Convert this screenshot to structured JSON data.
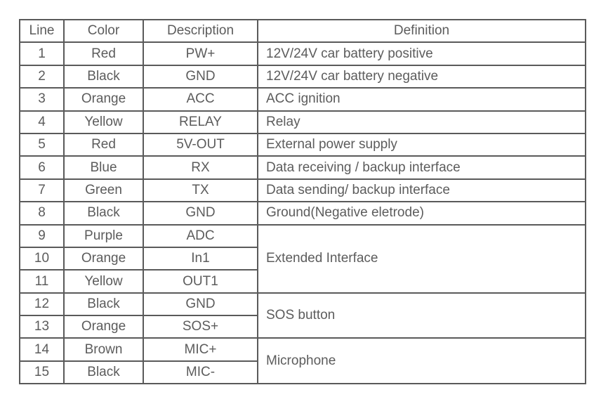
{
  "table": {
    "columns": [
      {
        "key": "line",
        "label": "Line"
      },
      {
        "key": "color",
        "label": "Color"
      },
      {
        "key": "description",
        "label": "Description"
      },
      {
        "key": "definition",
        "label": "Definition"
      }
    ],
    "rows": [
      {
        "line": "1",
        "color": "Red",
        "description": "PW+",
        "definition": "12V/24V car battery positive"
      },
      {
        "line": "2",
        "color": "Black",
        "description": "GND",
        "definition": "12V/24V car battery negative"
      },
      {
        "line": "3",
        "color": "Orange",
        "description": "ACC",
        "definition": "ACC ignition"
      },
      {
        "line": "4",
        "color": "Yellow",
        "description": "RELAY",
        "definition": "Relay"
      },
      {
        "line": "5",
        "color": "Red",
        "description": "5V-OUT",
        "definition": "External power supply"
      },
      {
        "line": "6",
        "color": "Blue",
        "description": "RX",
        "definition": "Data receiving / backup interface"
      },
      {
        "line": "7",
        "color": "Green",
        "description": "TX",
        "definition": "Data sending/ backup interface"
      },
      {
        "line": "8",
        "color": "Black",
        "description": "GND",
        "definition": "Ground(Negative eletrode)"
      },
      {
        "line": "9",
        "color": "Purple",
        "description": "ADC",
        "definition": "Extended Interface",
        "definition_rowspan": 3
      },
      {
        "line": "10",
        "color": "Orange",
        "description": "In1",
        "definition": null
      },
      {
        "line": "11",
        "color": "Yellow",
        "description": "OUT1",
        "definition": null
      },
      {
        "line": "12",
        "color": "Black",
        "description": "GND",
        "definition": "SOS button",
        "definition_rowspan": 2
      },
      {
        "line": "13",
        "color": "Orange",
        "description": "SOS+",
        "definition": null
      },
      {
        "line": "14",
        "color": "Brown",
        "description": "MIC+",
        "definition": "Microphone",
        "definition_rowspan": 2
      },
      {
        "line": "15",
        "color": "Black",
        "description": "MIC-",
        "definition": null
      }
    ]
  },
  "style": {
    "border_color": "#5a5a5a",
    "text_color": "#5c5c5c",
    "background": "#ffffff"
  }
}
